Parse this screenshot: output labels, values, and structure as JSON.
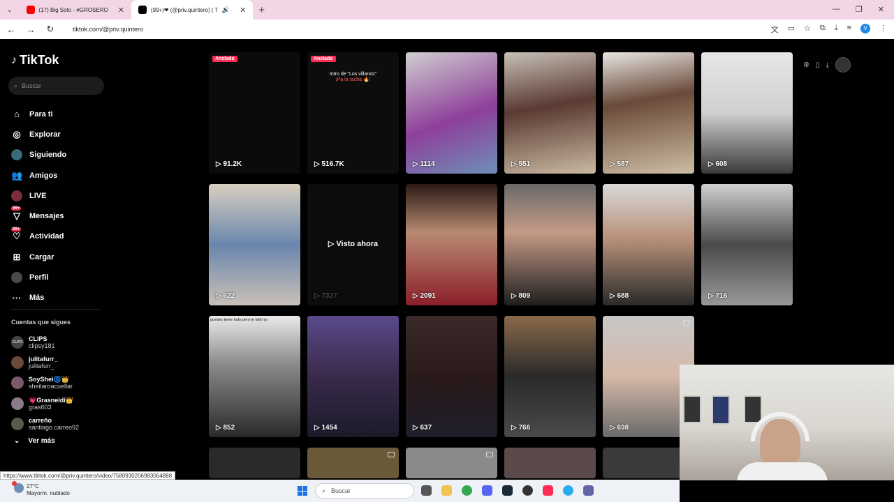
{
  "browser": {
    "tabs": [
      {
        "label": "(17) Big Soto - #GROSERO",
        "active": false
      },
      {
        "label": "(99+)❤ (@priv.quintero) | T",
        "active": true
      }
    ],
    "url": "tiktok.com/@priv.quintero",
    "status_url": "https://www.tiktok.com/@priv.quintero/video/7580930206983064888"
  },
  "tiktok": {
    "logo": "TikTok",
    "search_placeholder": "Buscar",
    "nav": [
      {
        "label": "Para ti",
        "icon": "home-icon"
      },
      {
        "label": "Explorar",
        "icon": "compass-icon"
      },
      {
        "label": "Siguiendo",
        "icon": "following-icon"
      },
      {
        "label": "Amigos",
        "icon": "friends-icon"
      },
      {
        "label": "LIVE",
        "icon": "live-icon"
      },
      {
        "label": "Mensajes",
        "icon": "messages-icon",
        "badge": "99+"
      },
      {
        "label": "Actividad",
        "icon": "activity-icon",
        "badge": "99+"
      },
      {
        "label": "Cargar",
        "icon": "upload-icon"
      },
      {
        "label": "Perfil",
        "icon": "profile-icon"
      },
      {
        "label": "Más",
        "icon": "more-icon"
      }
    ],
    "following_title": "Cuentas que sigues",
    "following": [
      {
        "name": "CLIPS",
        "handle": "clipsy181"
      },
      {
        "name": "julitafurr_",
        "handle": "julitafurr_"
      },
      {
        "name": "SoyShei🌀👑",
        "handle": "sheilaroacuellar"
      },
      {
        "name": "💗Grasneidi👑",
        "handle": "gras603"
      },
      {
        "name": "carreño",
        "handle": "santiago.carreo92"
      }
    ],
    "see_more": "Ver más"
  },
  "videos": [
    {
      "views": "91.2K",
      "pinned": "Anclado"
    },
    {
      "views": "516.7K",
      "pinned": "Anclado",
      "caption": "Intro de \"Los villanos\"",
      "caption2": "¡Pa la racha 🔥!"
    },
    {
      "views": "1114"
    },
    {
      "views": "551"
    },
    {
      "views": "587"
    },
    {
      "views": "608"
    },
    {
      "views": "622"
    },
    {
      "views": "7327",
      "watched": "Visto ahora"
    },
    {
      "views": "2091"
    },
    {
      "views": "809"
    },
    {
      "views": "688"
    },
    {
      "views": "716"
    },
    {
      "views": "852",
      "caption": "puedes tener todo pero te faltó yo"
    },
    {
      "views": "1454"
    },
    {
      "views": "637"
    },
    {
      "views": "766"
    },
    {
      "views": "698"
    }
  ],
  "taskbar": {
    "temperature": "27°C",
    "weather": "Mayorm. nublado",
    "search": "Buscar"
  },
  "colors": {
    "tiktok_red": "#fe2c55",
    "tab_strip": "#f3d6e6"
  }
}
